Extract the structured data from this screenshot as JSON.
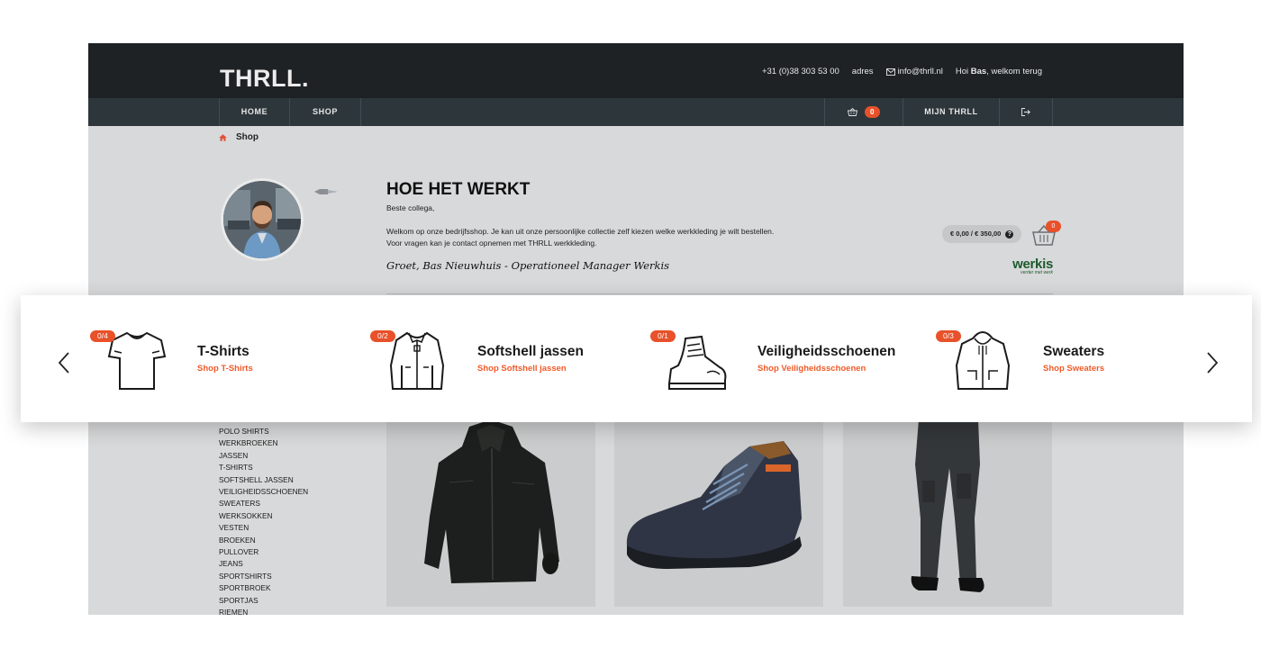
{
  "header": {
    "logo": "THRLL.",
    "phone": "+31 (0)38 303 53 00",
    "address_link": "adres",
    "email": "info@thrll.nl",
    "greeting_prefix": "Hoi",
    "user_name": "Bas",
    "greeting_suffix": ", welkom terug"
  },
  "nav": {
    "home": "HOME",
    "shop": "SHOP",
    "cart_count": "0",
    "account": "MIJN THRLL"
  },
  "breadcrumb": {
    "current": "Shop"
  },
  "intro": {
    "title": "HOE HET WERKT",
    "greeting": "Beste collega,",
    "body": "Welkom op onze bedrijfsshop. Je kan uit onze persoonlijke collectie zelf kiezen welke werkkleding je wilt bestellen. Voor vragen kan je contact opnemen met THRLL werkkleding.",
    "signature": "Groet, Bas Nieuwhuis - Operationeel Manager Werkis"
  },
  "budget": {
    "text": "€ 0,00 / € 350,00",
    "help": "?",
    "basket_count": "0"
  },
  "brand": {
    "name": "werkis",
    "tagline": "verder met werk"
  },
  "categories": [
    {
      "badge": "0/4",
      "title": "T-Shirts",
      "link": "Shop T-Shirts",
      "icon": "tshirt-icon"
    },
    {
      "badge": "0/2",
      "title": "Softshell jassen",
      "link": "Shop Softshell jassen",
      "icon": "jacket-icon"
    },
    {
      "badge": "0/1",
      "title": "Veiligheidsschoenen",
      "link": "Shop Veiligheidsschoenen",
      "icon": "boot-icon"
    },
    {
      "badge": "0/3",
      "title": "Sweaters",
      "link": "Shop Sweaters",
      "icon": "hoodie-icon"
    }
  ],
  "category_list": [
    "POLO SHIRTS",
    "WERKBROEKEN",
    "JASSEN",
    "T-SHIRTS",
    "SOFTSHELL JASSEN",
    "VEILIGHEIDSSCHOENEN",
    "SWEATERS",
    "WERKSOKKEN",
    "VESTEN",
    "BROEKEN",
    "PULLOVER",
    "JEANS",
    "SPORTSHIRTS",
    "SPORTBROEK",
    "SPORTJAS",
    "RIEMEN"
  ],
  "products": [
    {
      "icon": "softshell-jacket-image"
    },
    {
      "icon": "safety-shoe-image"
    },
    {
      "icon": "work-trousers-image"
    }
  ],
  "colors": {
    "accent": "#f05a28",
    "topbar": "#1e2225",
    "navbar": "#2d363b",
    "page": "#d8d9da"
  }
}
